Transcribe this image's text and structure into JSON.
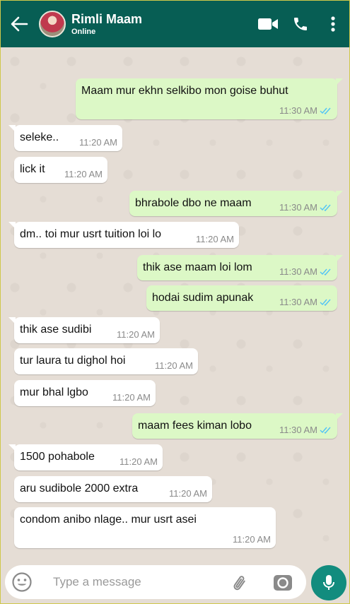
{
  "header": {
    "contact_name": "Rimli Maam",
    "status": "Online",
    "icons": [
      "back-arrow-icon",
      "video-call-icon",
      "voice-call-icon",
      "more-options-icon"
    ]
  },
  "messages": [
    {
      "dir": "out",
      "text": "Maam mur ekhn selkibo mon goise buhut",
      "time": "11:30 AM",
      "read": true
    },
    {
      "dir": "in",
      "text": "seleke..",
      "time": "11:20 AM"
    },
    {
      "dir": "in",
      "text": "lick it",
      "time": "11:20 AM"
    },
    {
      "dir": "out",
      "text": "bhrabole dbo ne maam",
      "time": "11:30 AM",
      "read": true
    },
    {
      "dir": "in",
      "text": "dm.. toi mur usrt tuition loi lo",
      "time": "11:20 AM"
    },
    {
      "dir": "out",
      "text": "thik ase maam loi lom",
      "time": "11:30 AM",
      "read": true
    },
    {
      "dir": "out",
      "text": "hodai sudim apunak",
      "time": "11:30 AM",
      "read": true
    },
    {
      "dir": "in",
      "text": "thik ase sudibi",
      "time": "11:20 AM"
    },
    {
      "dir": "in",
      "text": "tur laura tu dighol hoi",
      "time": "11:20 AM"
    },
    {
      "dir": "in",
      "text": "mur bhal lgbo",
      "time": "11:20 AM"
    },
    {
      "dir": "out",
      "text": "maam fees kiman lobo",
      "time": "11:30 AM",
      "read": true
    },
    {
      "dir": "in",
      "text": "1500 pohabole",
      "time": "11:20 AM"
    },
    {
      "dir": "in",
      "text": "aru sudibole 2000 extra",
      "time": "11:20 AM"
    },
    {
      "dir": "in",
      "text": "condom anibo nlage.. mur usrt asei",
      "time": "11:20 AM"
    }
  ],
  "composer": {
    "placeholder": "Type a message",
    "value": ""
  },
  "colors": {
    "header_bg": "#075e54",
    "outgoing_bubble": "#dcf8c6",
    "incoming_bubble": "#ffffff",
    "chat_bg": "#e5ddd5",
    "mic_button": "#128c7e",
    "read_tick": "#4fc3f7"
  }
}
